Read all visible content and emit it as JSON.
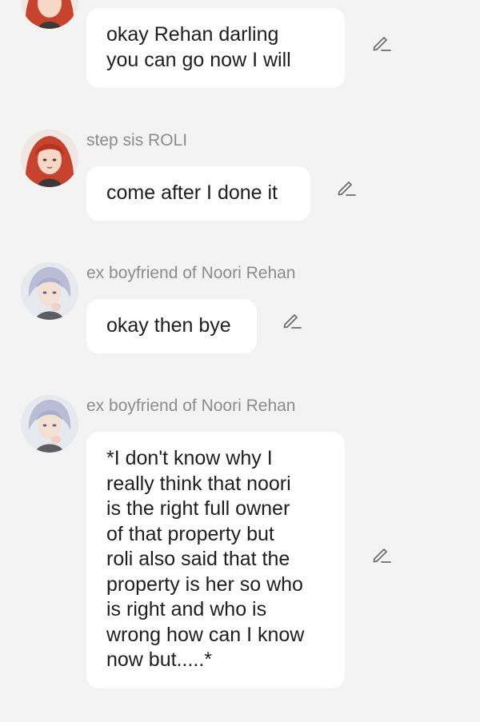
{
  "messages": [
    {
      "avatar": "girl-red-hair-avatar",
      "sender": "",
      "lines": [
        "okay Rehan darling",
        "you can go now I will"
      ],
      "edit_icon": "pencil-edit-icon"
    },
    {
      "avatar": "girl-red-hair-avatar",
      "sender": "step sis ROLI",
      "lines": [
        "come after I done it"
      ],
      "edit_icon": "pencil-edit-icon"
    },
    {
      "avatar": "boy-silver-hair-avatar",
      "sender": "ex boyfriend of Noori Rehan",
      "lines": [
        "okay then bye"
      ],
      "edit_icon": "pencil-edit-icon"
    },
    {
      "avatar": "boy-silver-hair-avatar",
      "sender": "ex boyfriend of Noori Rehan",
      "lines": [
        "*I don't know why I",
        "really think that noori",
        "is the right full owner",
        "of that property but",
        "roli also said that the",
        "property is her so who",
        "is right and who is",
        "wrong how can I know",
        "now but.....*"
      ],
      "edit_icon": "pencil-edit-icon"
    }
  ],
  "colors": {
    "background": "#f3f3f3",
    "bubble": "#ffffff",
    "text": "#1e1e1e",
    "sender": "#8c8c8c",
    "icon": "#6e6e6e"
  }
}
